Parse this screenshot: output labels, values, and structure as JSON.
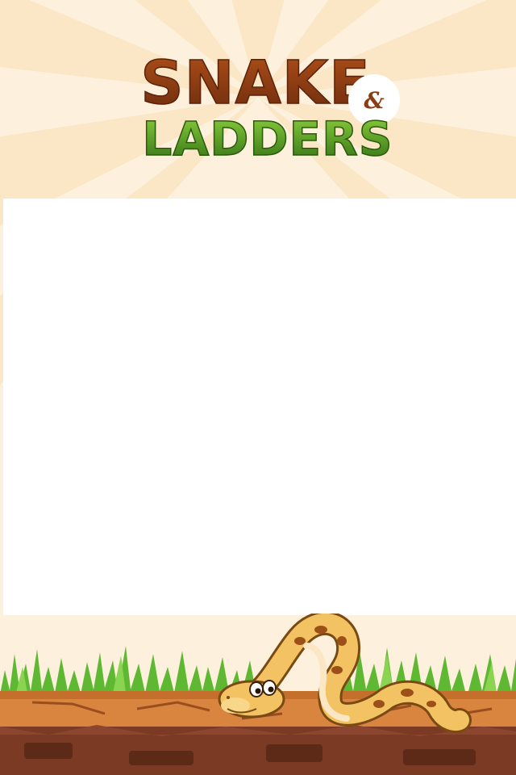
{
  "title": {
    "line1": "SNAKE",
    "ampersand": "&",
    "line2": "LADDERS"
  },
  "colors": {
    "background": "#fdf1de",
    "ray": "#fbe6c4",
    "snake_title": "#8a3c12",
    "ladders_title": "#4a8a1a",
    "panel": "#ffffff",
    "grass": "#6cc23a",
    "soil_top": "#d4803e",
    "soil_dark": "#7a3a24"
  },
  "icons": {
    "mascot": "snake-mascot-icon"
  }
}
